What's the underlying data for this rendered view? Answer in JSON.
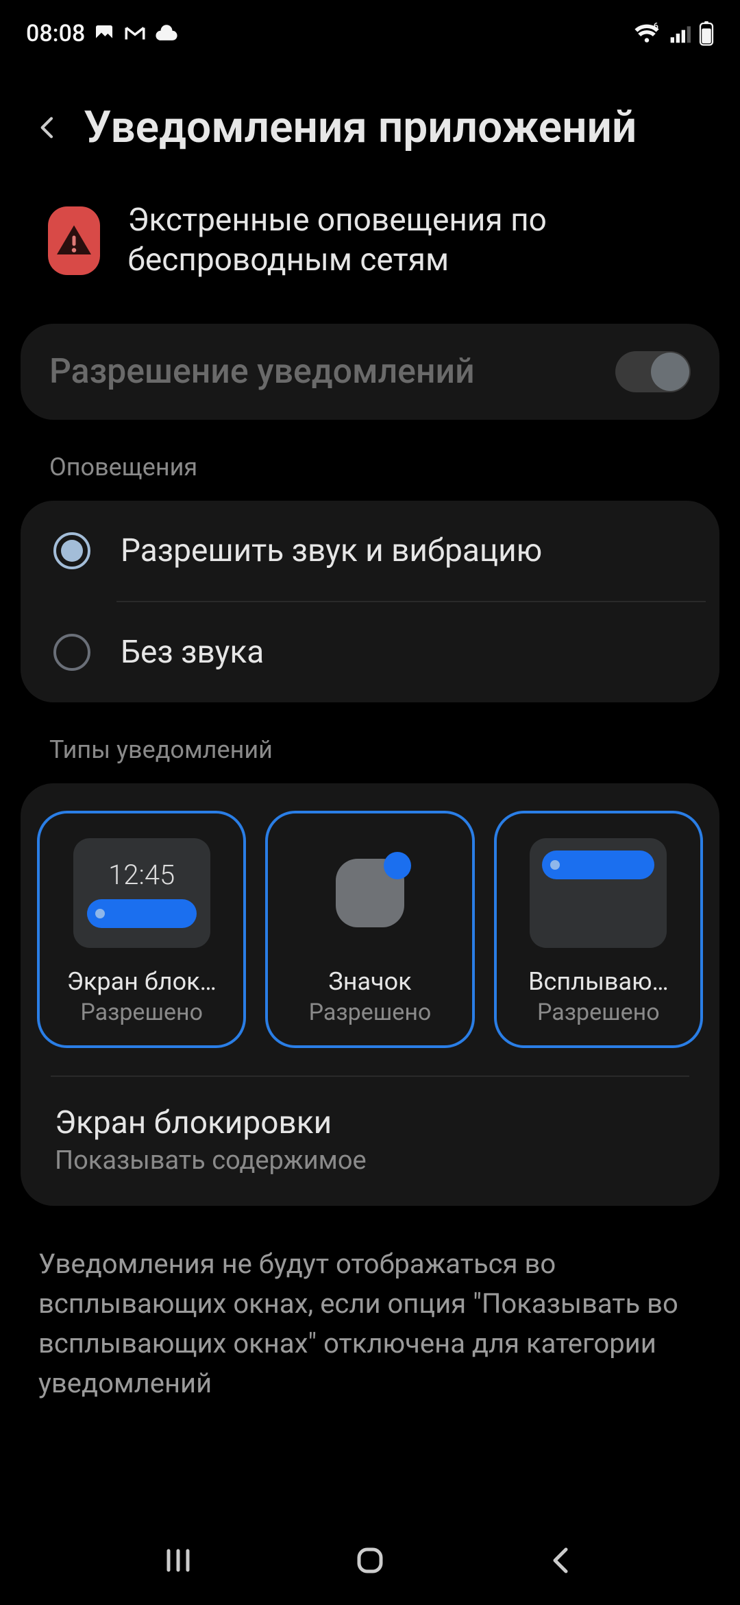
{
  "status": {
    "time": "08:08"
  },
  "header": {
    "title": "Уведомления приложений"
  },
  "app": {
    "name": "Экстренные оповещения по беспроводным сетям"
  },
  "notifications_permission": {
    "label": "Разрешение уведомлений",
    "enabled": true
  },
  "alerts": {
    "section_label": "Оповещения",
    "options": [
      {
        "label": "Разрешить звук и вибрацию",
        "selected": true
      },
      {
        "label": "Без звука",
        "selected": false
      }
    ]
  },
  "types": {
    "section_label": "Типы уведомлений",
    "preview_time": "12:45",
    "items": [
      {
        "title": "Экран блок…",
        "status": "Разрешено"
      },
      {
        "title": "Значок",
        "status": "Разрешено"
      },
      {
        "title": "Всплываю…",
        "status": "Разрешено"
      }
    ]
  },
  "lockscreen": {
    "title": "Экран блокировки",
    "subtitle": "Показывать содержимое"
  },
  "footer": {
    "note": "Уведомления не будут отображаться во всплывающих окнах, если опция \"Показывать во всплывающих окнах\" отключена для категории уведомлений"
  }
}
